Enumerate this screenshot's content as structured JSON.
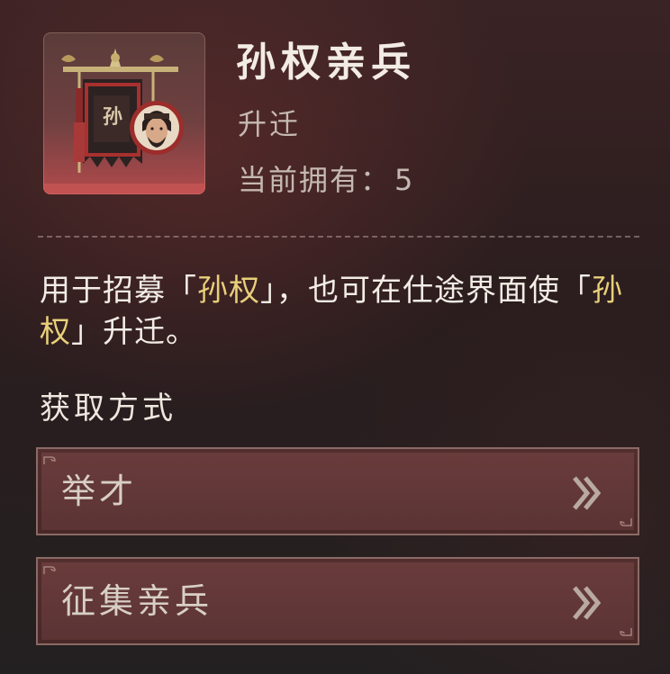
{
  "item": {
    "name": "孙权亲兵",
    "category": "升迁",
    "owned_label": "当前拥有：",
    "owned_value": "5",
    "icon": "sun-quan-guard-banner-icon",
    "icon_banner_char": "孙"
  },
  "description": {
    "part1": "用于招募「",
    "name1": "孙权",
    "part2": "」，也可在仕途界面使「",
    "name2": "孙权",
    "part3": "」升迁。"
  },
  "acquire": {
    "title": "获取方式",
    "methods": [
      {
        "label": "举才",
        "icon": "double-chevron-right-icon"
      },
      {
        "label": "征集亲兵",
        "icon": "double-chevron-right-icon"
      }
    ]
  },
  "colors": {
    "highlight": "#e8cf7a",
    "button_bg": "#5f3737",
    "button_border": "#8b6a65"
  }
}
